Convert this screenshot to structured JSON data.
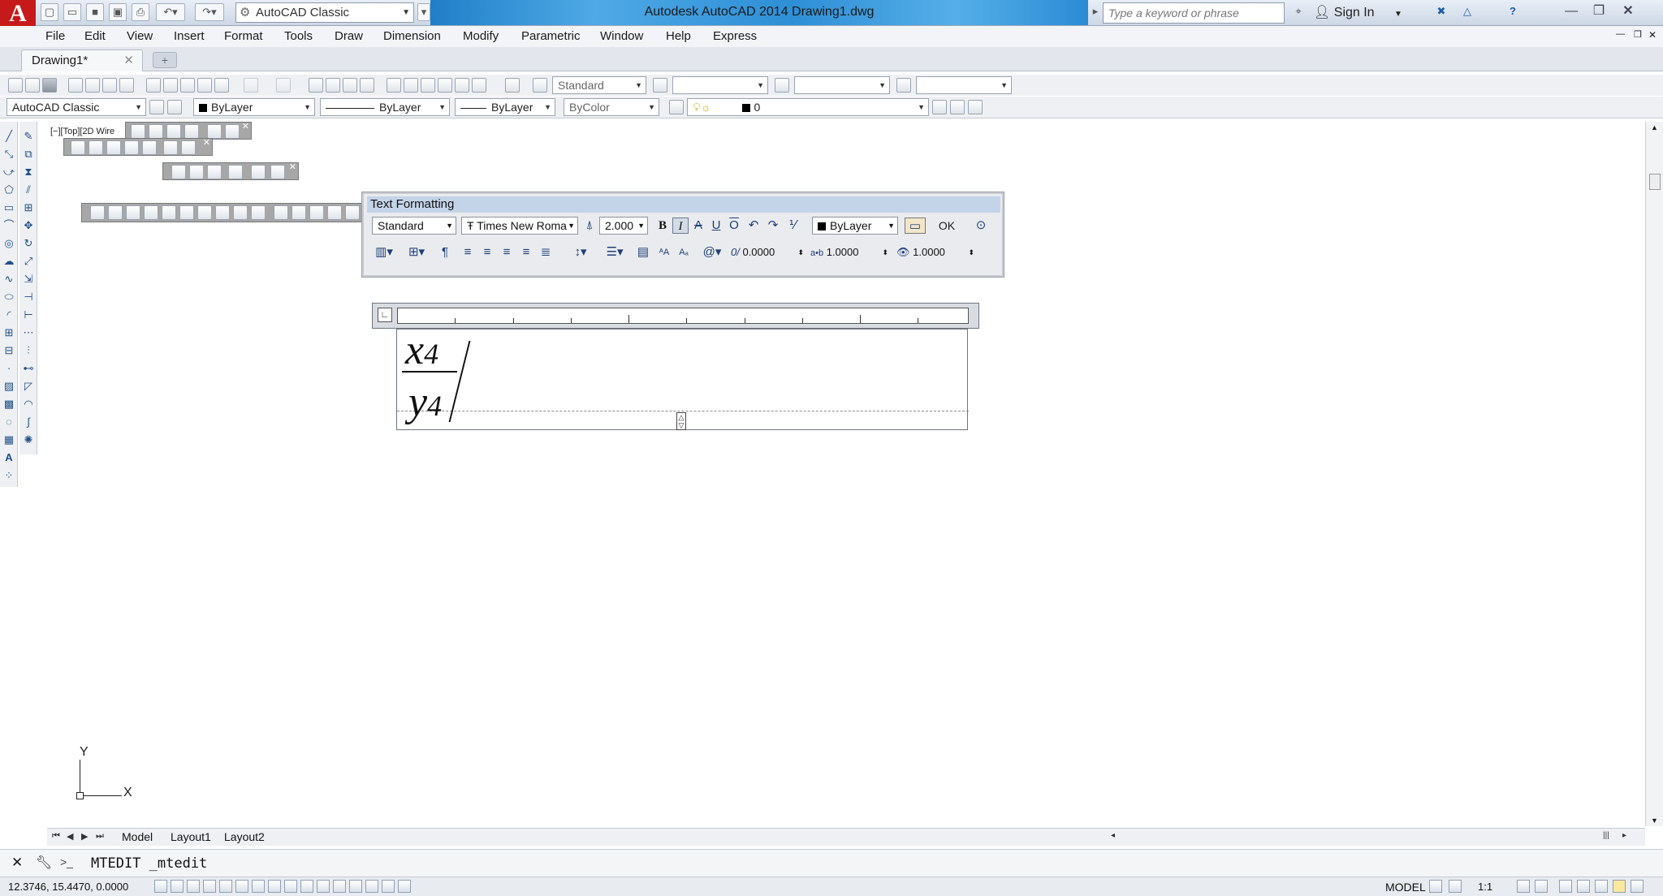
{
  "app": {
    "logo_letter": "A",
    "title": "Autodesk AutoCAD 2014    Drawing1.dwg",
    "workspace": "AutoCAD Classic",
    "search_placeholder": "Type a keyword or phrase",
    "signin_label": "Sign In"
  },
  "menu": [
    "File",
    "Edit",
    "View",
    "Insert",
    "Format",
    "Tools",
    "Draw",
    "Dimension",
    "Modify",
    "Parametric",
    "Window",
    "Help",
    "Express"
  ],
  "file_tab": {
    "label": "Drawing1*"
  },
  "toolbar1": {
    "text_style": "Standard"
  },
  "toolbar2": {
    "workspace": "AutoCAD Classic",
    "color": "ByLayer",
    "linetype": "ByLayer",
    "lineweight": "ByLayer",
    "plotstyle": "ByColor",
    "layer": "0"
  },
  "viewport_label": "[−][Top][2D Wire",
  "text_formatting": {
    "title": "Text Formatting",
    "style": "Standard",
    "font": "Times New Roma",
    "height": "2.000",
    "color": "ByLayer",
    "ok_label": "OK",
    "oblique": "0.0000",
    "tracking": "1.0000",
    "width_factor": "1.0000",
    "oblique_prefix": "0/",
    "tracking_prefix": "a•b",
    "bold_label": "B",
    "italic_label": "I",
    "strike_label": "A",
    "underline_label": "U",
    "overline_label": "O"
  },
  "editor": {
    "numerator": "x",
    "numerator_sub": "4",
    "denominator": "y",
    "denominator_sub": "4"
  },
  "ucs": {
    "x_label": "X",
    "y_label": "Y"
  },
  "layout_tabs": [
    "Model",
    "Layout1",
    "Layout2"
  ],
  "command": {
    "text": "MTEDIT _mtedit",
    "prompt": ">_"
  },
  "status": {
    "coords": "12.3746, 15.4470, 0.0000",
    "model_label": "MODEL",
    "scale": "1:1"
  }
}
